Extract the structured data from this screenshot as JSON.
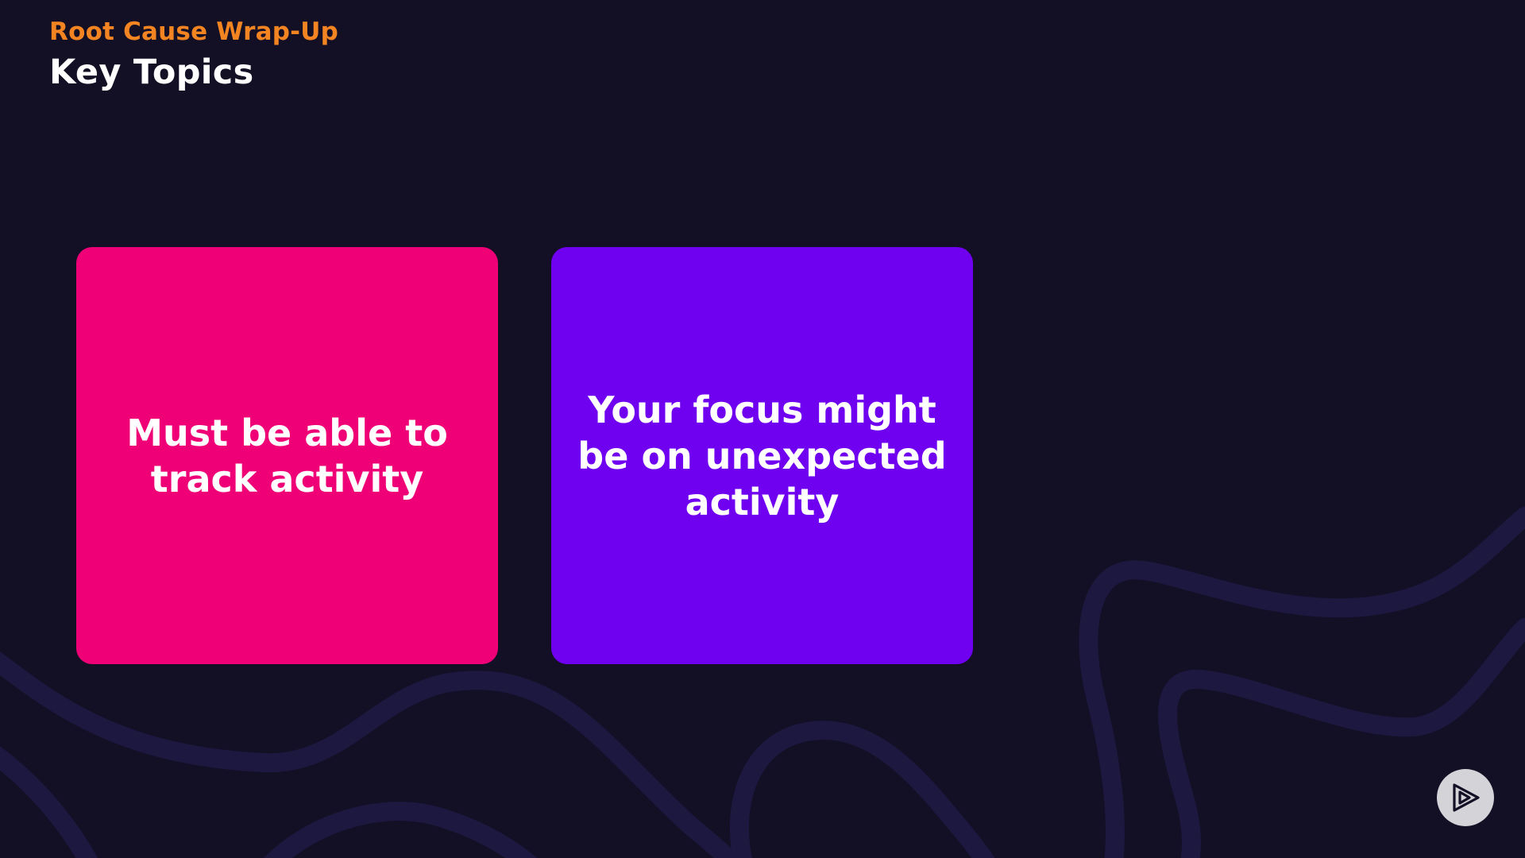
{
  "header": {
    "section_label": "Root Cause Wrap-Up",
    "title": "Key Topics"
  },
  "cards": [
    {
      "text": "Must be able to track activity",
      "color": "#ef0077"
    },
    {
      "text": "Your focus might be on unexpected activity",
      "color": "#7000f0"
    }
  ],
  "controls": {
    "play_icon": "play-icon"
  },
  "colors": {
    "background": "#130f25",
    "accent": "#f38422",
    "wave": "#1d1840"
  }
}
